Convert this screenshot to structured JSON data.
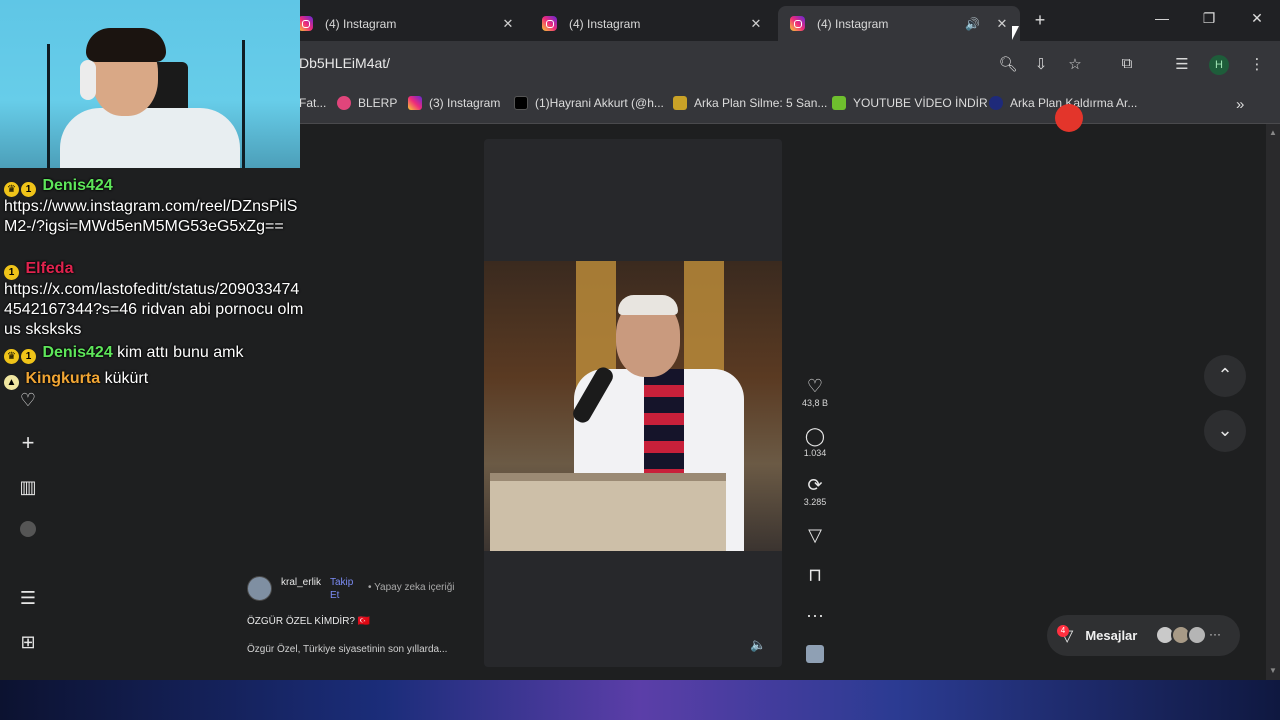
{
  "tabs": [
    {
      "title": "(4) Instagram",
      "close": "✕"
    },
    {
      "title": "(4) Instagram",
      "close": "✕"
    },
    {
      "title": "(4) Instagram",
      "close": "✕",
      "audio": "🔊"
    }
  ],
  "tabstrip": {
    "new_tab": "+",
    "minimize": "—",
    "restore": "❐",
    "close": "✕"
  },
  "toolbar": {
    "url": "Db5HLEiM4at/",
    "profile_initial": "H"
  },
  "bookmarks": [
    {
      "label": "Fat..."
    },
    {
      "label": "BLERP",
      "color": "#e0457b"
    },
    {
      "label": "(3) Instagram",
      "color": "#d6249f"
    },
    {
      "label": "(1)Hayrani Akkurt (@h...",
      "color": "#000000"
    },
    {
      "label": "Arka Plan Silme: 5 San...",
      "color": "#c9a227"
    },
    {
      "label": "YOUTUBE VİDEO İNDİR",
      "color": "#6fbf2e"
    },
    {
      "label": "Arka Plan Kaldırma Ar...",
      "color": "#1e2a7a"
    }
  ],
  "bookmarks_more": "»",
  "post": {
    "likes": "43,8 B",
    "comments": "1.034",
    "reposts": "3.285",
    "username": "kral_erlik",
    "follow": "Takip Et",
    "ai_label": "• Yapay zeka içeriği",
    "title": "ÖZGÜR ÖZEL KİMDİR? 🇹🇷",
    "text": "Özgür Özel, Türkiye siyasetinin son yıllarda..."
  },
  "messages": {
    "label": "Mesajlar",
    "badge": "4",
    "more": "···"
  },
  "nav": {
    "up": "⌃",
    "down": "⌄"
  },
  "chat": [
    {
      "user": "Denis424",
      "user_color": "#5ee65a",
      "msg": "https://www.instagram.com/reel/DZnsPilSM2-/?igsi=MWd5enM5MG53eG5xZg=="
    },
    {
      "user": "Elfeda",
      "user_color": "#e0234e",
      "msg": "https://x.com/lastofeditt/status/2090334744542167344?s=46 ridvan abi pornocu olmus sksksks"
    },
    {
      "user": "Denis424",
      "user_color": "#5ee65a",
      "msg": "kim attı bunu amk"
    },
    {
      "user": "Kingkurta",
      "user_color": "#f0a534",
      "msg": "kükürt"
    }
  ],
  "colors": {
    "accent": "#7c8cf5",
    "badge": "#ff3040"
  }
}
